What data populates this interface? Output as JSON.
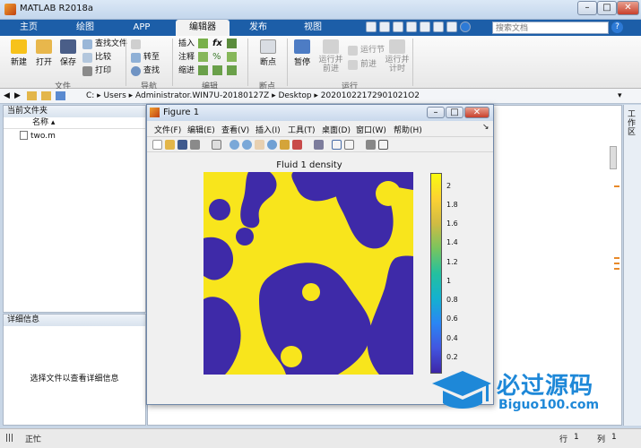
{
  "window": {
    "title": "MATLAB R2018a"
  },
  "tabs": [
    "主页",
    "绘图",
    "APP",
    "编辑器",
    "发布",
    "视图"
  ],
  "search": {
    "placeholder": "搜索文档"
  },
  "ribbon": {
    "file": {
      "group": "文件",
      "new": "新建",
      "open": "打开",
      "save": "保存",
      "find_files": "查找文件",
      "compare": "比较",
      "print": "打印"
    },
    "nav": {
      "group": "导航",
      "goto": "转至",
      "find": "查找"
    },
    "edit": {
      "group": "编辑",
      "insert": "插入",
      "comment": "注释",
      "indent": "缩进"
    },
    "breakpoints": {
      "group": "断点",
      "label": "断点"
    },
    "run": {
      "group": "运行",
      "pause": "暂停",
      "run_advance": "运行并\n前进",
      "run_section": "运行节",
      "advance": "前进",
      "run_time": "运行并\n计时"
    }
  },
  "address": {
    "path": "C: ▸ Users ▸ Administrator.WIN7U-20180127Z ▸ Desktop ▸ 20201022172901021O2"
  },
  "current_folder": {
    "title": "当前文件夹",
    "column": "名称",
    "files": [
      "two.m"
    ]
  },
  "details": {
    "title": "详细信息",
    "hint": "选择文件以查看详细信息"
  },
  "side_label": "工作区",
  "status": {
    "left": "正忙",
    "row_label": "行",
    "row": "1",
    "col_label": "列",
    "col": "1"
  },
  "figure": {
    "title": "Figure 1",
    "menu": [
      "文件(F)",
      "编辑(E)",
      "查看(V)",
      "插入(I)",
      "工具(T)",
      "桌面(D)",
      "窗口(W)",
      "帮助(H)"
    ],
    "plot_title": "Fluid 1 density",
    "colorbar_ticks": [
      "2",
      "1.8",
      "1.6",
      "1.4",
      "1.2",
      "1",
      "0.8",
      "0.6",
      "0.4",
      "0.2"
    ]
  },
  "watermark": {
    "name": "必过源码",
    "url": "Biguo100.com"
  },
  "colors": {
    "high": "#f8e51c",
    "low": "#3e2aa8"
  }
}
